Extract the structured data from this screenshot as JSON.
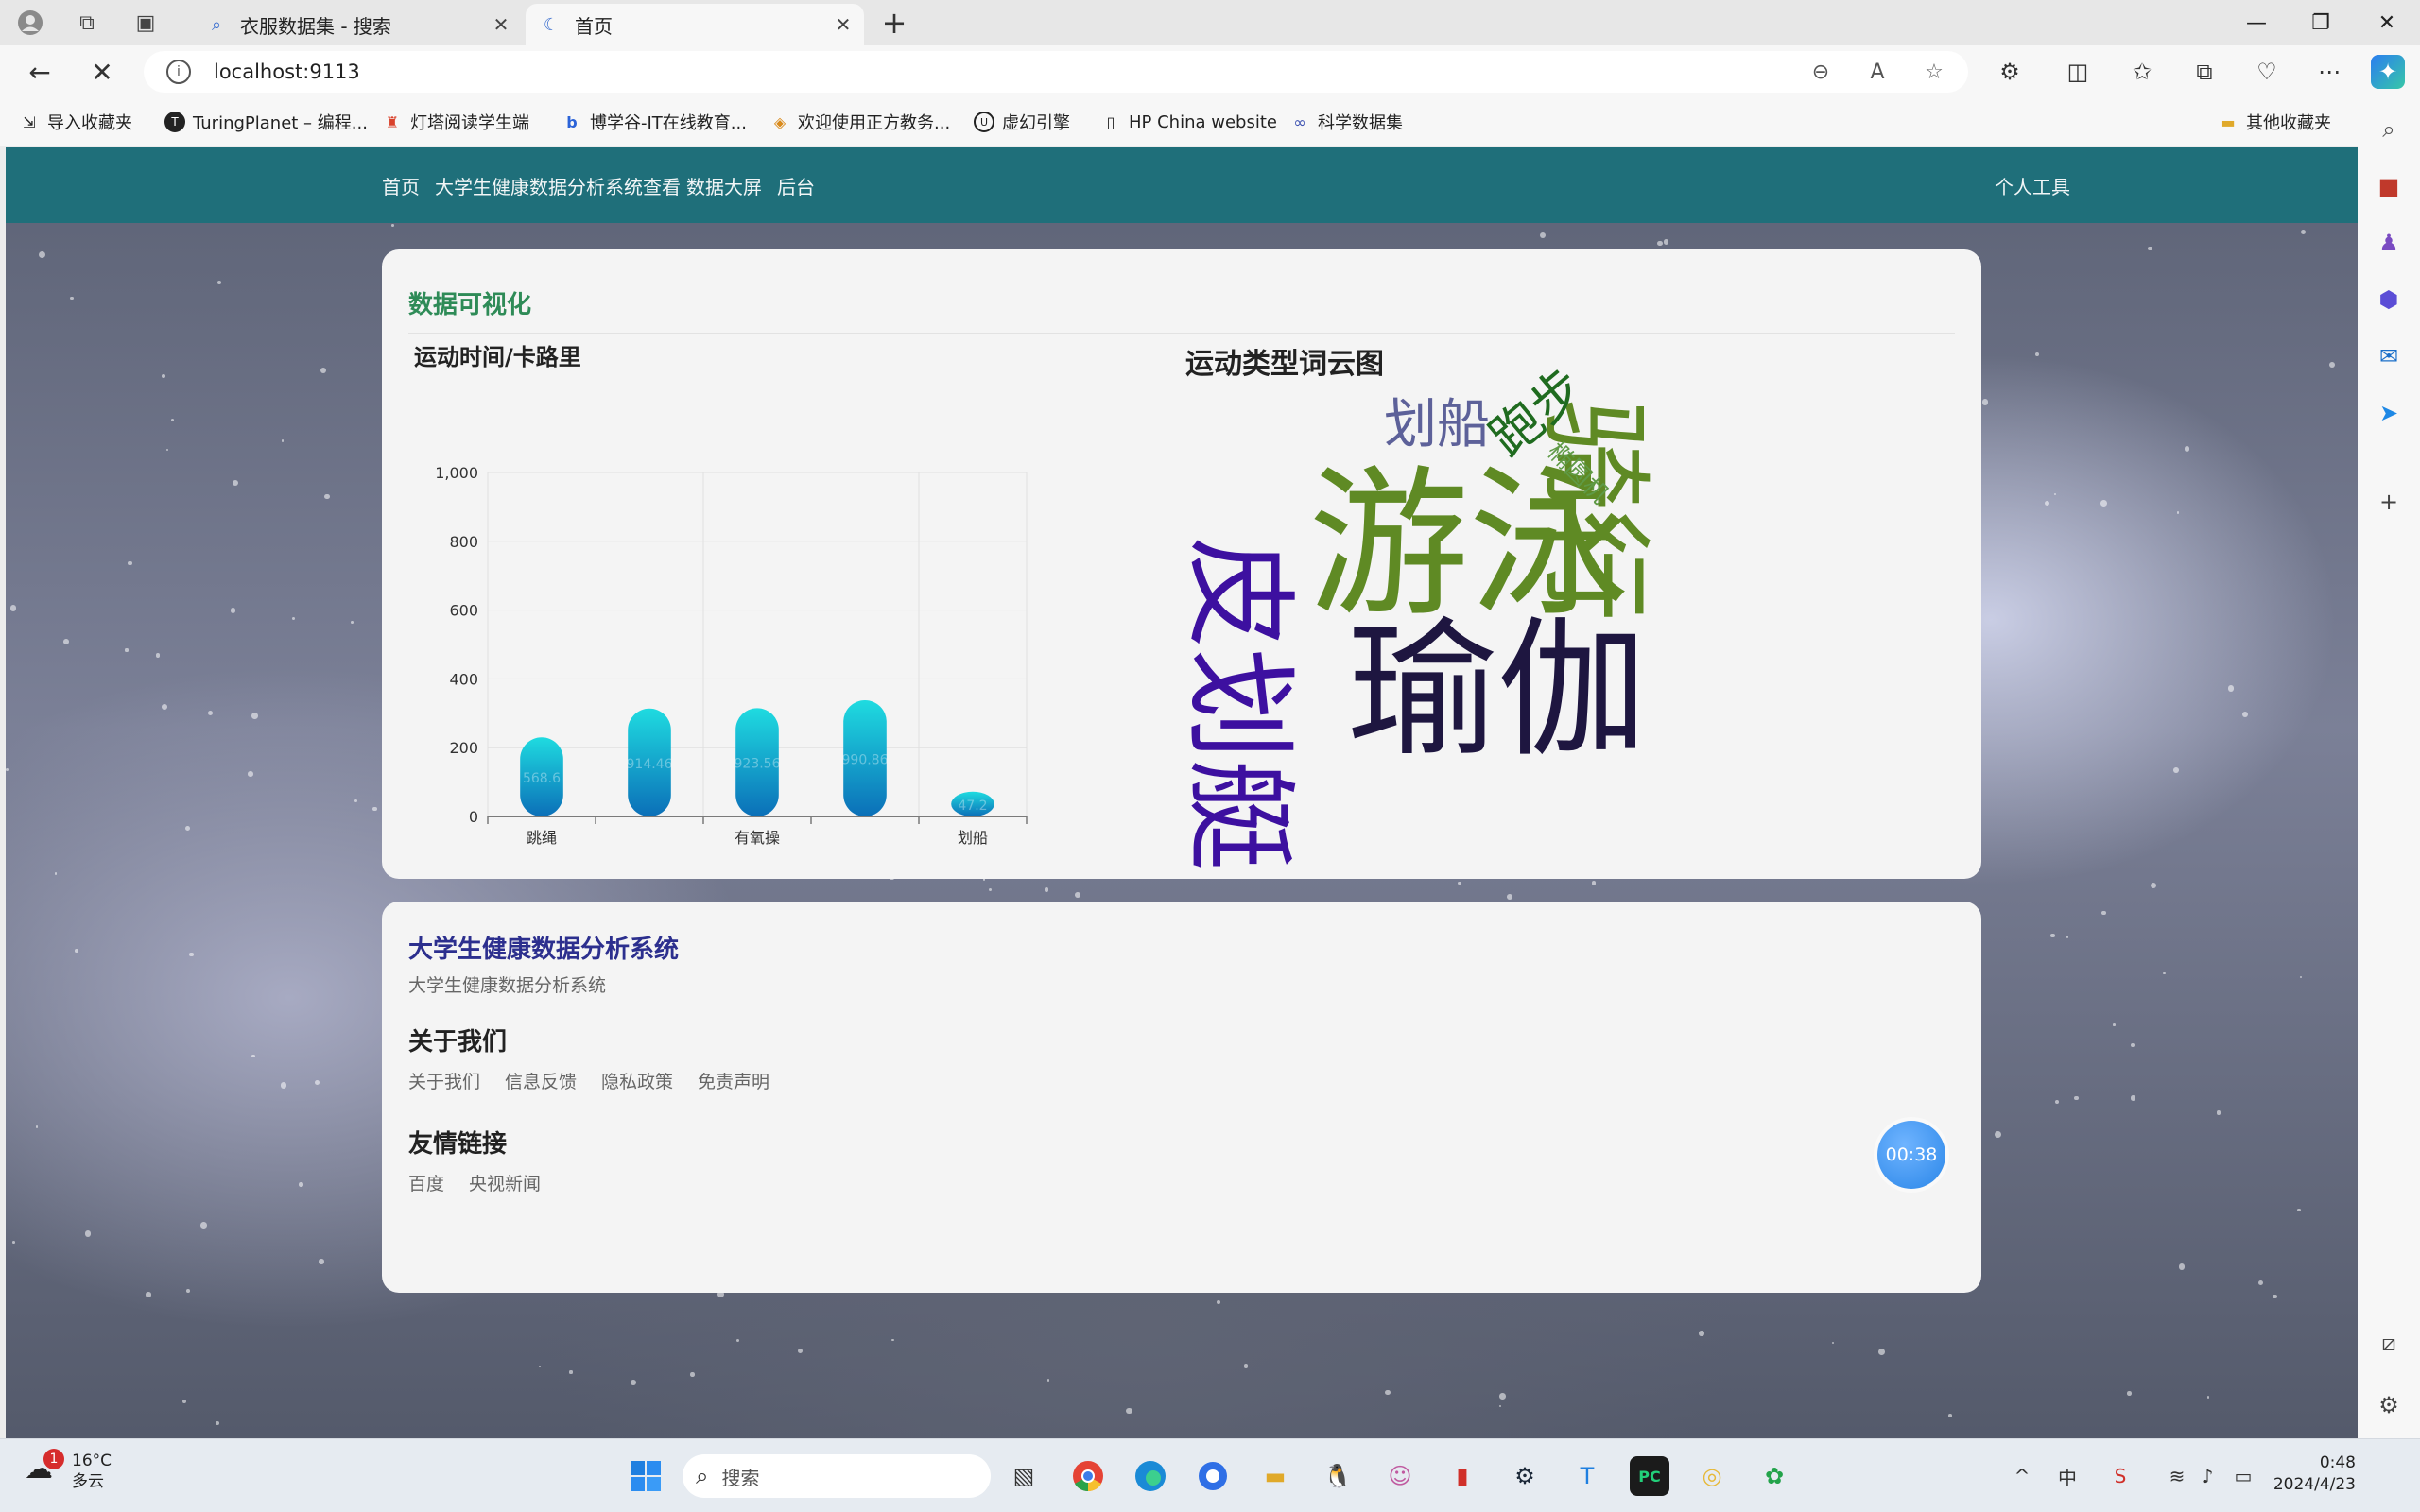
{
  "browser": {
    "tabs": [
      {
        "label": "衣服数据集 - 搜索",
        "icon": "search-icon"
      },
      {
        "label": "首页",
        "icon": "loading-icon"
      }
    ],
    "url": "localhost:9113",
    "bookmarks": [
      {
        "label": "导入收藏夹",
        "icon": "import-icon"
      },
      {
        "label": "TuringPlanet – 编程...",
        "icon": "turing-icon"
      },
      {
        "label": "灯塔阅读学生端",
        "icon": "lighthouse-icon"
      },
      {
        "label": "博学谷-IT在线教育...",
        "icon": "boxuegu-icon"
      },
      {
        "label": "欢迎使用正方教务...",
        "icon": "zhengfang-icon"
      },
      {
        "label": "虚幻引擎",
        "icon": "unreal-icon"
      },
      {
        "label": "HP China website",
        "icon": "page-icon"
      },
      {
        "label": "科学数据集",
        "icon": "infinity-icon"
      }
    ],
    "other_bookmarks": "其他收藏夹"
  },
  "site": {
    "nav": [
      "首页",
      "大学生健康数据分析系统查看",
      "数据大屏",
      "后台"
    ],
    "nav_right": "个人工具",
    "viz_title": "数据可视化",
    "chart_title": "运动时间/卡路里",
    "cloud_title": "运动类型词云图",
    "word_cloud": [
      {
        "text": "游泳",
        "color": "#5f8a24"
      },
      {
        "text": "瑜伽",
        "color": "#1e1640"
      },
      {
        "text": "皮划艇",
        "color": "#3d10a0"
      },
      {
        "text": "骑行",
        "color": "#5f8a24"
      },
      {
        "text": "划船",
        "color": "#5d6199"
      },
      {
        "text": "跑步",
        "color": "#1f6b1f"
      },
      {
        "text": "椭圆机",
        "color": "#5f9a46"
      }
    ],
    "footer": {
      "system_title": "大学生健康数据分析系统",
      "system_subtitle": "大学生健康数据分析系统",
      "about_title": "关于我们",
      "about_links": [
        "关于我们",
        "信息反馈",
        "隐私政策",
        "免责声明"
      ],
      "friends_title": "友情链接",
      "friends_links": [
        "百度",
        "央视新闻"
      ]
    },
    "timer": "00:38"
  },
  "chart_data": {
    "type": "bar",
    "title": "运动时间/卡路里",
    "x_tick_labels_shown": [
      "跳绳",
      "",
      "有氧操",
      "",
      "划船"
    ],
    "values": [
      230,
      314,
      315,
      338,
      72
    ],
    "data_labels": [
      "568.6",
      "914.46",
      "923.56",
      "990.86",
      "47.2"
    ],
    "yticks": [
      0,
      200,
      400,
      600,
      800,
      "1,000"
    ],
    "ylim": [
      0,
      1000
    ],
    "grid": true,
    "bar_colors": [
      "#1fdbe0",
      "#0b6fb8"
    ]
  },
  "taskbar": {
    "weather_temp": "16°C",
    "weather_desc": "多云",
    "weather_badge": "1",
    "search_placeholder": "搜索",
    "time": "0:48",
    "date": "2024/4/23",
    "ime": "中"
  }
}
